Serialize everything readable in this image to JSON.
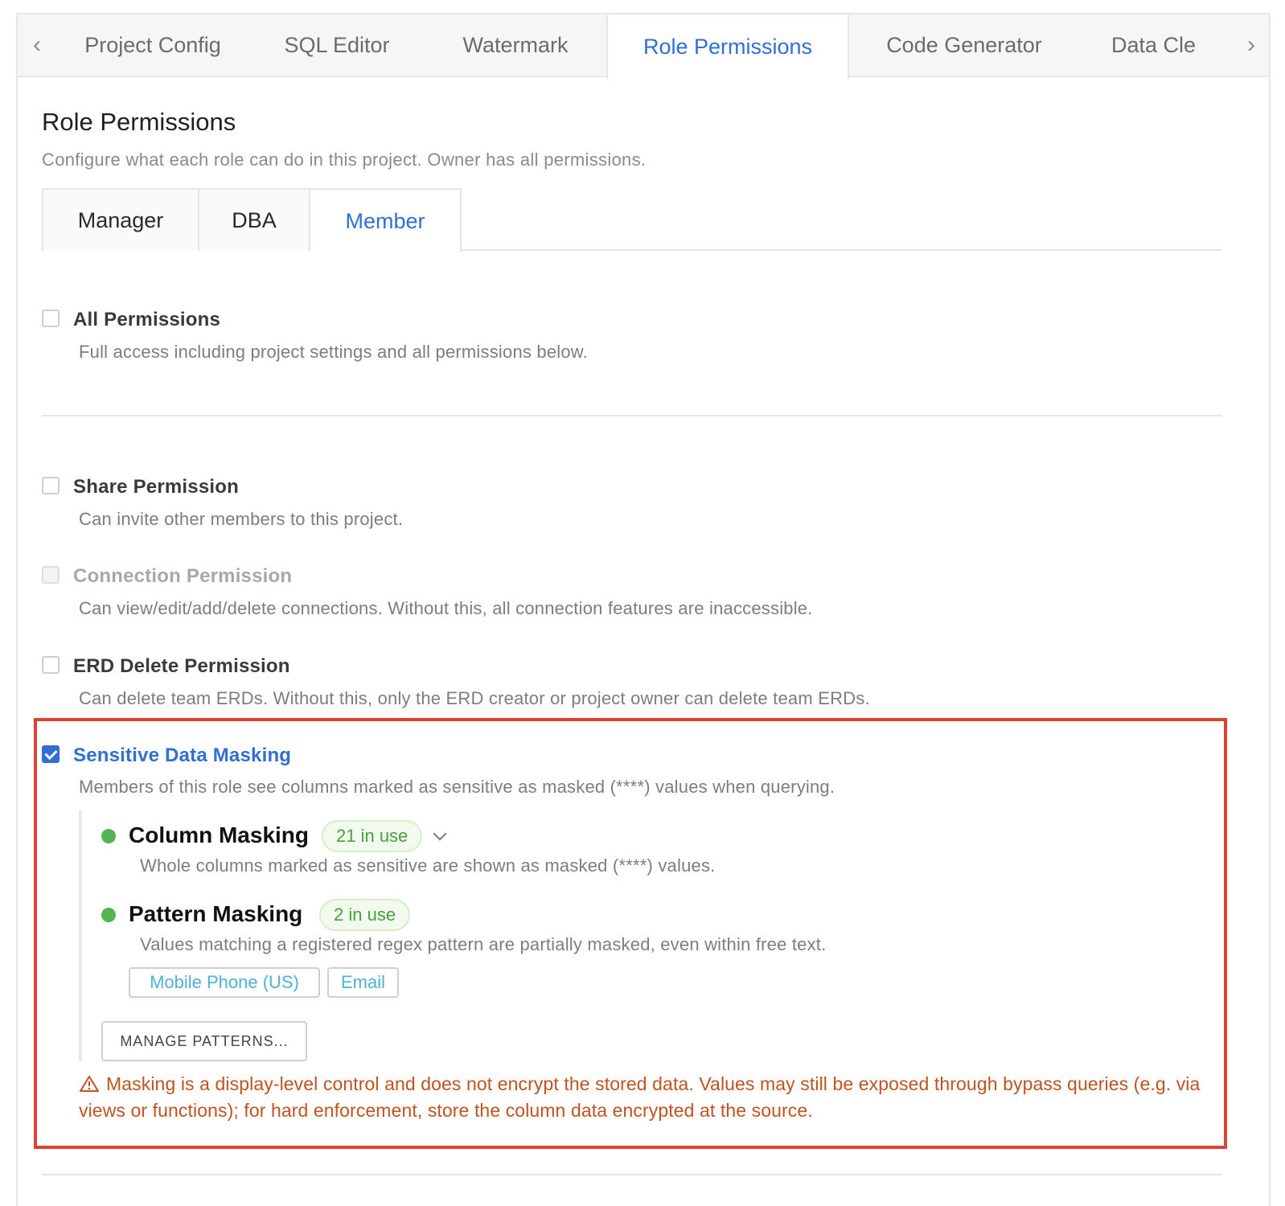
{
  "top_tabs": {
    "items": [
      "Project Config",
      "SQL Editor",
      "Watermark",
      "Role Permissions",
      "Code Generator",
      "Data Cle"
    ],
    "active_index": 3,
    "prev_icon": "chevron-left-icon",
    "next_icon": "chevron-right-icon"
  },
  "header": {
    "title": "Role Permissions",
    "subtitle": "Configure what each role can do in this project. Owner has all permissions."
  },
  "role_tabs": {
    "items": [
      "Manager",
      "DBA",
      "Member"
    ],
    "active_index": 2
  },
  "permissions": {
    "all": {
      "label": "All Permissions",
      "desc": "Full access including project settings and all permissions below.",
      "checked": false
    },
    "share": {
      "label": "Share Permission",
      "desc": "Can invite other members to this project.",
      "checked": false
    },
    "connection": {
      "label": "Connection Permission",
      "desc": "Can view/edit/add/delete connections. Without this, all connection features are inaccessible.",
      "checked": false,
      "disabled": true
    },
    "erd_delete": {
      "label": "ERD Delete Permission",
      "desc": "Can delete team ERDs. Without this, only the ERD creator or project owner can delete team ERDs.",
      "checked": false
    },
    "masking": {
      "label": "Sensitive Data Masking",
      "desc": "Members of this role see columns marked as sensitive as masked (****) values when querying.",
      "checked": true
    }
  },
  "masking": {
    "column": {
      "title": "Column Masking",
      "badge": "21 in use",
      "desc": "Whole columns marked as sensitive are shown as masked (****) values."
    },
    "pattern": {
      "title": "Pattern Masking",
      "badge": "2 in use",
      "desc": "Values matching a registered regex pattern are partially masked, even within free text.",
      "tags": [
        "Mobile Phone (US)",
        "Email"
      ]
    },
    "manage_button": "MANAGE PATTERNS...",
    "warning": "Masking is a display-level control and does not encrypt the stored data. Values may still be exposed through bypass queries (e.g. via views or functions); for hard enforcement, store the column data encrypted at the source."
  },
  "colors": {
    "accent": "#2f6fd6",
    "success_dot": "#52b551",
    "warning_text": "#c2521f",
    "highlight_border": "#e0402f"
  }
}
